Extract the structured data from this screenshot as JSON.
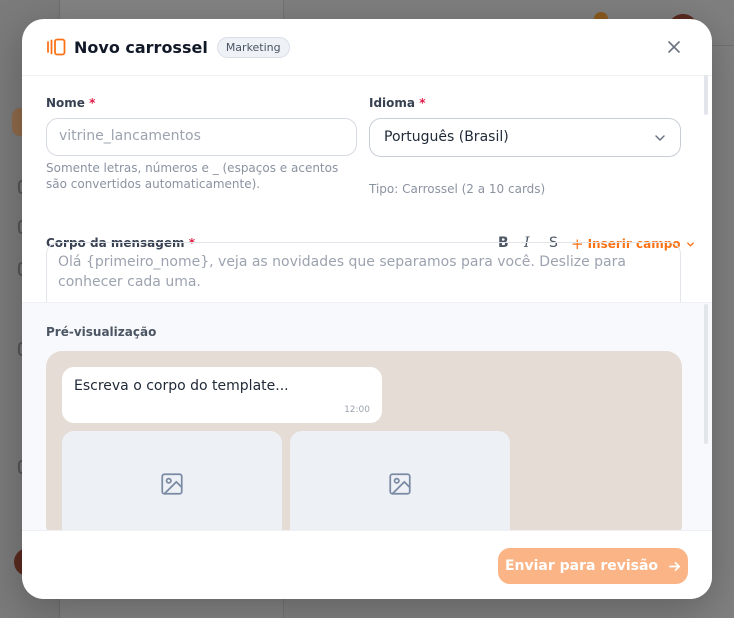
{
  "modal": {
    "title": "Novo carrossel",
    "badge": "Marketing",
    "close_icon": "close-icon",
    "title_icon": "carousel-icon"
  },
  "form": {
    "name": {
      "label": "Nome",
      "required_mark": "*",
      "placeholder": "vitrine_lancamentos",
      "hint": "Somente letras, números e _ (espaços e acentos são convertidos automaticamente)."
    },
    "language": {
      "label": "Idioma",
      "required_mark": "*",
      "value": "Português (Brasil)",
      "hint": "Tipo: Carrossel (2 a 10 cards)"
    },
    "body": {
      "label": "Corpo da mensagem",
      "required_mark": "*",
      "placeholder": "Olá {primeiro_nome}, veja as novidades que separamos para você. Deslize para conhecer cada uma.",
      "toolbar": {
        "bold": "B",
        "italic": "I",
        "strike": "S",
        "insert_field": "Inserir campo"
      }
    }
  },
  "preview": {
    "label": "Pré-visualização",
    "bubble_text": "Escreva o corpo do template...",
    "bubble_time": "12:00",
    "cards": [
      {
        "icon": "image-placeholder-icon"
      },
      {
        "icon": "image-placeholder-icon"
      }
    ]
  },
  "footer": {
    "submit_label": "Enviar para revisão"
  },
  "colors": {
    "accent": "#f97316",
    "submit_disabled": "#fbb486",
    "chat_bg": "#e5ddd5"
  }
}
